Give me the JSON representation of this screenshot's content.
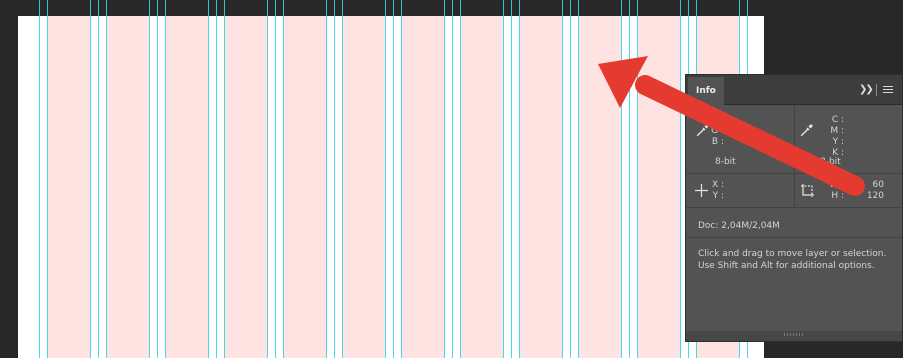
{
  "panel": {
    "tab_label": "Info",
    "expand_icon": "double-chevron-right-icon",
    "menu_icon": "hamburger-menu-icon",
    "color_readout_left": {
      "icon": "eyedropper-icon",
      "labels": [
        "R :",
        "G :",
        "B :"
      ],
      "bit_depth": "8-bit"
    },
    "color_readout_right": {
      "icon": "eyedropper-icon",
      "labels": [
        "C :",
        "M :",
        "Y :",
        "K :"
      ],
      "bit_depth": "8-bit"
    },
    "position_readout": {
      "icon": "crosshair-icon",
      "labels": [
        "X :",
        "Y :"
      ]
    },
    "size_readout": {
      "icon": "selection-rectangle-icon",
      "labels": [
        "W :",
        "H :"
      ],
      "values": [
        "60",
        "120"
      ]
    },
    "doc_size": "Doc: 2,04M/2,04M",
    "hint_line1": "Click and drag to move layer or selection.",
    "hint_line2": "Use Shift and Alt for additional options."
  },
  "canvas": {
    "background_color": "#ffffff",
    "column_color": "#ffe3e3",
    "guide_color": "#34d7e2",
    "workspace_color": "#282828"
  },
  "annotation": {
    "arrow_color": "#e53a2f",
    "arrow_icon": "red-arrow-annotation-icon"
  }
}
